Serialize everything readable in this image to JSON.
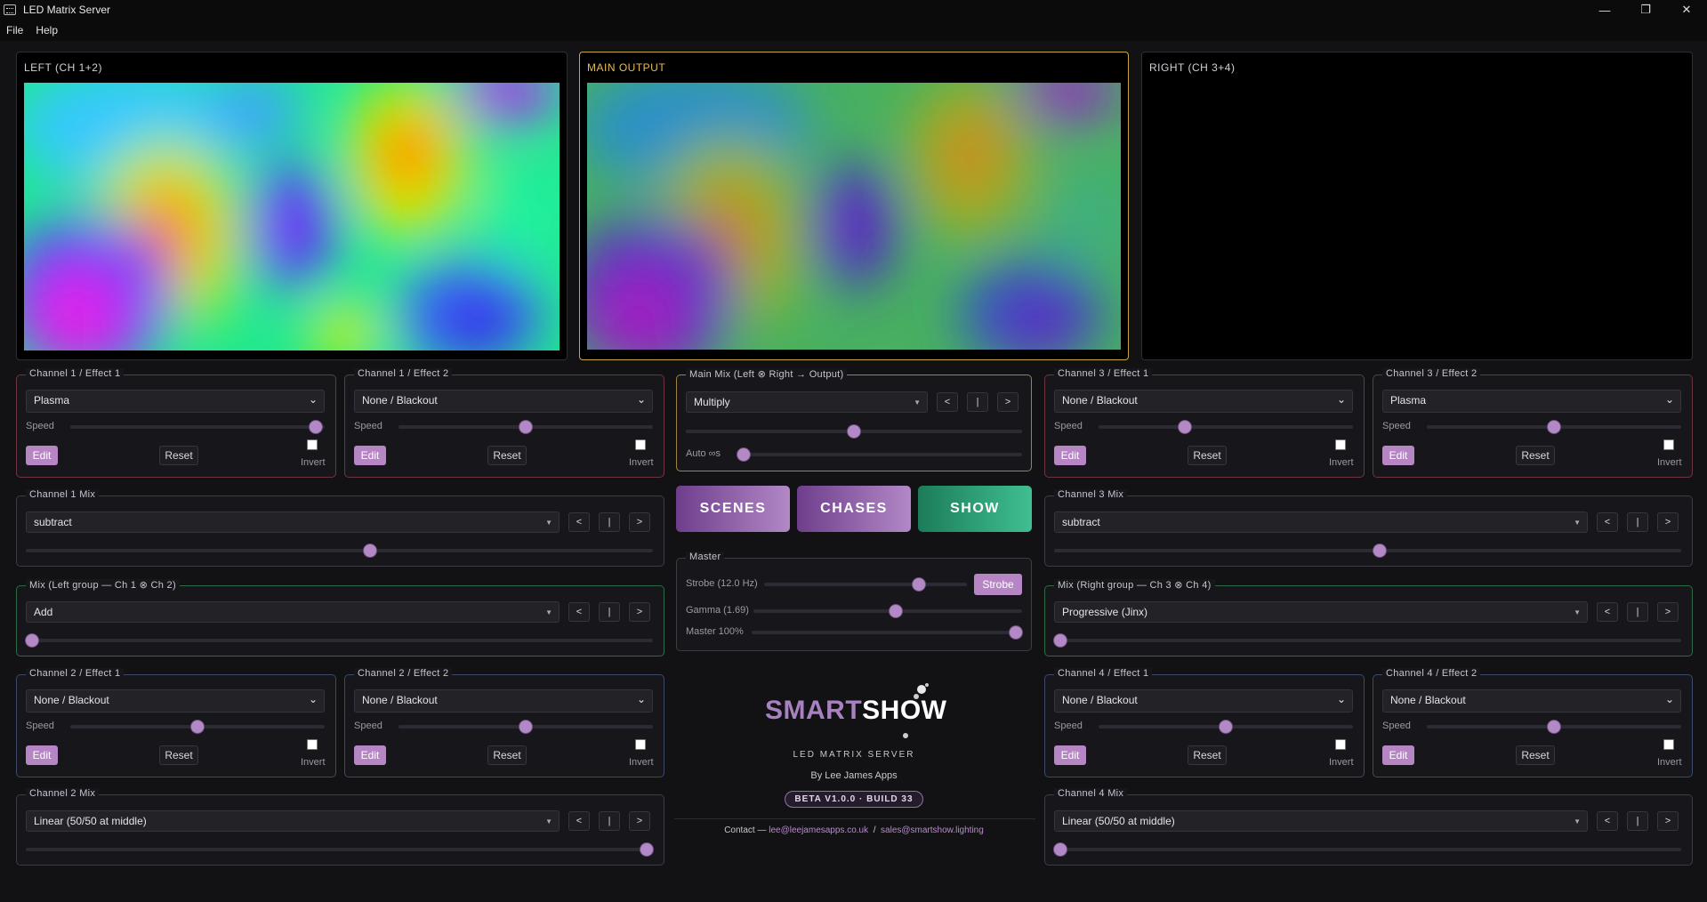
{
  "window": {
    "title": "LED Matrix Server",
    "controls": [
      "—",
      "❐",
      "✕"
    ]
  },
  "menu": [
    "File",
    "Help"
  ],
  "previews": {
    "left": "LEFT (CH 1+2)",
    "main": "MAIN OUTPUT",
    "right": "RIGHT (CH 3+4)"
  },
  "common": {
    "speed": "Speed",
    "edit": "Edit",
    "reset": "Reset",
    "invert": "Invert",
    "prev": "<",
    "center": "|",
    "next": ">"
  },
  "effects": {
    "ch1e1": {
      "title": "Channel 1 / Effect 1",
      "value": "Plasma",
      "speed": 0.99
    },
    "ch1e2": {
      "title": "Channel 1 / Effect 2",
      "value": "None / Blackout",
      "speed": 0.5
    },
    "ch2e1": {
      "title": "Channel 2 / Effect 1",
      "value": "None / Blackout",
      "speed": 0.5
    },
    "ch2e2": {
      "title": "Channel 2 / Effect 2",
      "value": "None / Blackout",
      "speed": 0.5
    },
    "ch3e1": {
      "title": "Channel 3 / Effect 1",
      "value": "None / Blackout",
      "speed": 0.33
    },
    "ch3e2": {
      "title": "Channel 3 / Effect 2",
      "value": "Plasma",
      "speed": 0.5
    },
    "ch4e1": {
      "title": "Channel 4 / Effect 1",
      "value": "None / Blackout",
      "speed": 0.5
    },
    "ch4e2": {
      "title": "Channel 4 / Effect 2",
      "value": "None / Blackout",
      "speed": 0.5
    }
  },
  "mixes": {
    "ch1": {
      "title": "Channel 1 Mix",
      "value": "subtract",
      "level": 0.55
    },
    "leftgroup": {
      "title": "Mix (Left group — Ch 1 ⊗ Ch 2)",
      "value": "Add",
      "level": 0.0
    },
    "ch2": {
      "title": "Channel 2 Mix",
      "value": "Linear (50/50 at middle)",
      "level": 1.0
    },
    "ch3": {
      "title": "Channel 3 Mix",
      "value": "subtract",
      "level": 0.52
    },
    "rightgroup": {
      "title": "Mix (Right group — Ch 3 ⊗ Ch 4)",
      "value": "Progressive (Jinx)",
      "level": 0.0
    },
    "ch4": {
      "title": "Channel 4 Mix",
      "value": "Linear (50/50 at middle)",
      "level": 0.0
    }
  },
  "main_mix": {
    "title": "Main Mix (Left ⊗ Right → Output)",
    "value": "Multiply",
    "level": 0.5,
    "auto_label": "Auto ∞s",
    "auto": 0.0
  },
  "big_buttons": {
    "scenes": "SCENES",
    "chases": "CHASES",
    "show": "SHOW"
  },
  "master": {
    "title": "Master",
    "strobe_label": "Strobe (12.0 Hz)",
    "strobe_level": 0.78,
    "strobe_button": "Strobe",
    "gamma_label": "Gamma (1.69)",
    "gamma_level": 0.53,
    "master_label": "Master 100%",
    "master_level": 1.0
  },
  "branding": {
    "logo_part1": "SMART",
    "logo_part2": "SHOW",
    "subtitle": "LED MATRIX SERVER",
    "author": "By Lee James Apps",
    "version": "BETA V1.0.0 · BUILD 33",
    "contact_label": "Contact —",
    "email1": "lee@leejamesapps.co.uk",
    "separator": "/",
    "email2": "sales@smartshow.lighting"
  },
  "colors": {
    "accent": "#b686c4",
    "main_output_border": "#c9a840",
    "show_button": "#2a9c74"
  }
}
